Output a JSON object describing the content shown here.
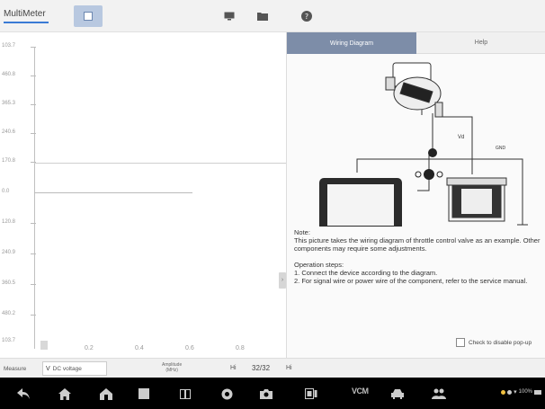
{
  "toolbar": {
    "title": "MultiMeter"
  },
  "scope": {
    "y_ticks": [
      "103.7",
      "460.8",
      "365.3",
      "240.6",
      "170.8",
      "0.0",
      "120.8",
      "240.9",
      "360.5",
      "480.2",
      "103.7"
    ],
    "center_label": "0.0",
    "x_ticks": [
      "0.2",
      "0.4",
      "0.6",
      "0.8"
    ]
  },
  "right_panel": {
    "tabs": {
      "wiring": "Wiring Diagram",
      "help": "Help"
    },
    "diagram_labels": {
      "vd": "Vd",
      "gnd": "GND"
    },
    "note_title": "Note:",
    "note_text": "This picture takes the wiring diagram of throttle control valve as an example. Other components may require some adjustments.",
    "ops_title": "Operation steps:",
    "op1": "1. Connect the device according to the diagram.",
    "op2": "2. For signal wire or power wire of the component, refer to the service manual.",
    "checkbox_label": "Check to disable pop-up"
  },
  "info_bar": {
    "measure_label": "Measure",
    "measure_value": "DC voltage",
    "amplitude_label": "Amplitude",
    "amplitude_sub": "(MHz)",
    "hi_label": "Hi",
    "count": "32/32",
    "hi_label_2": "Hi"
  },
  "navbar": {
    "vci": "VCM",
    "status": "100%"
  }
}
